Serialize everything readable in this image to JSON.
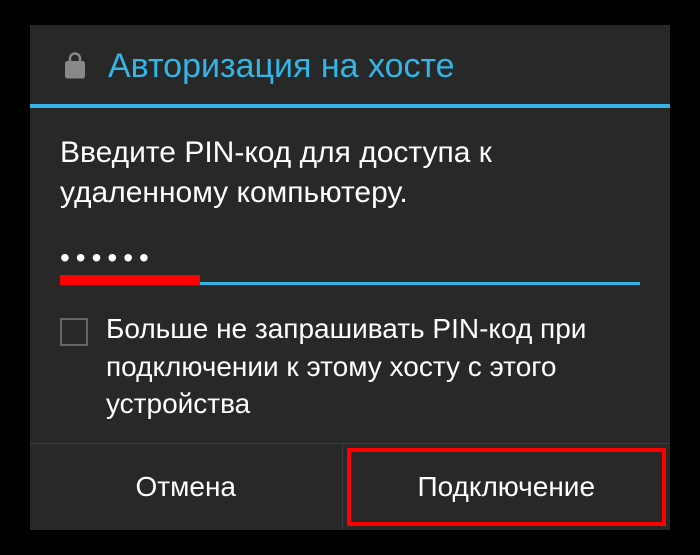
{
  "dialog": {
    "title": "Авторизация на хосте",
    "body": "Введите PIN-код для доступа к удаленному компьютеру.",
    "pin_masked": "••••••",
    "checkbox_label": "Больше не запрашивать PIN-код при подключении к этому хосту с этого устройства",
    "cancel_label": "Отмена",
    "connect_label": "Подключение"
  }
}
